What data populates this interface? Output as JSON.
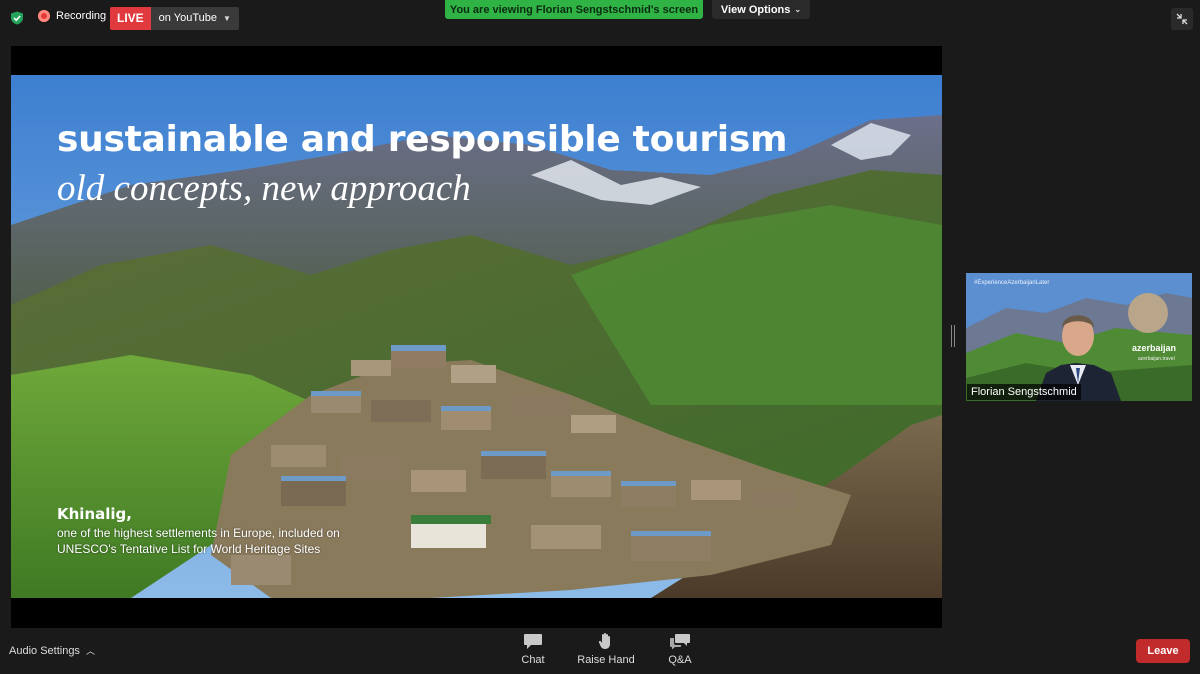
{
  "topbar": {
    "recording_label": "Recording",
    "live_label": "LIVE",
    "live_destination": "on YouTube",
    "viewing_banner": "You are viewing Florian Sengstschmid's screen",
    "view_options_label": "View Options"
  },
  "slide": {
    "title": "sustainable and responsible tourism",
    "subtitle": "old concepts, new approach",
    "caption_heading": "Khinalig,",
    "caption_line1": "one of the highest settlements in Europe, included on",
    "caption_line2": "UNESCO's Tentative List for World Heritage Sites"
  },
  "video": {
    "hashtag": "#ExperienceAzerbaijanLater",
    "brand": "azerbaijan",
    "brand_sub": "azerbaijan.travel",
    "participant_name": "Florian Sengstschmid"
  },
  "toolbar": {
    "audio_settings_label": "Audio Settings",
    "chat_label": "Chat",
    "raise_hand_label": "Raise Hand",
    "qa_label": "Q&A",
    "leave_label": "Leave"
  },
  "icons": {
    "shield": "shield-check-icon",
    "chat": "chat-bubble-icon",
    "raise_hand": "hand-icon",
    "qa": "qa-bubbles-icon",
    "exit_fullscreen": "exit-fullscreen-icon"
  },
  "colors": {
    "live_red": "#e0393e",
    "viewing_green": "#2fb344",
    "leave_red": "#c22b2b",
    "background": "#1a1a1a"
  }
}
